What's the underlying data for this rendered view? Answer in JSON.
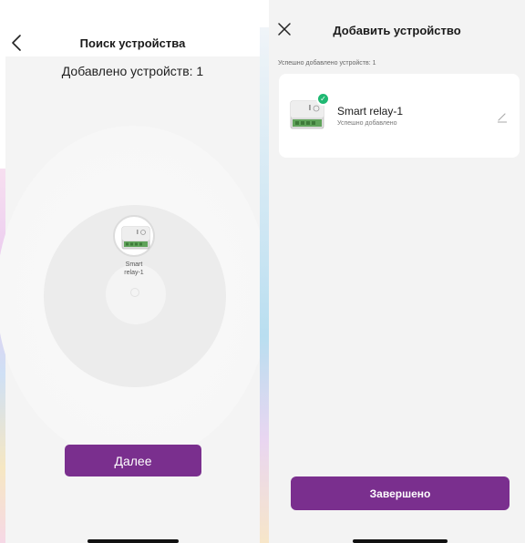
{
  "search_screen": {
    "title": "Поиск устройства",
    "back_icon": "chevron-left-icon",
    "added_count_text": "Добавлено устройств: 1",
    "device": {
      "name": "Smart relay-1",
      "icon": "relay-device-icon"
    },
    "next_button": "Далее"
  },
  "added_screen": {
    "title": "Добавить устройство",
    "close_icon": "close-icon",
    "success_count_text": "Успешно добавлено устройств: 1",
    "device": {
      "name": "Smart relay-1",
      "status": "Успешно добавлено",
      "icon": "relay-device-icon",
      "badge_icon": "checkmark-icon",
      "edit_icon": "pencil-icon"
    },
    "done_button": "Завершено"
  },
  "colors": {
    "accent": "#7a2f8e",
    "success": "#1fb872",
    "background": "#f3f3f3"
  }
}
